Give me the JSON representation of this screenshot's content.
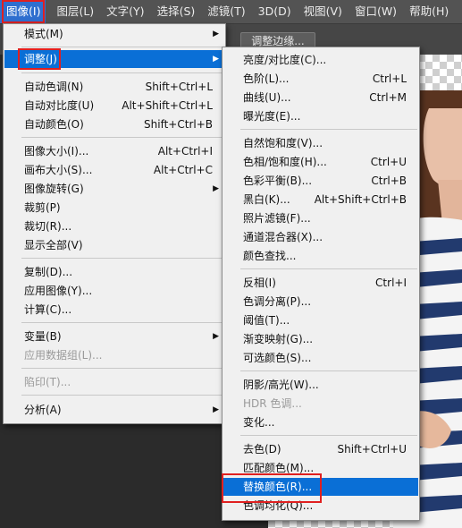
{
  "menubar": {
    "items": [
      "图像(I)",
      "图层(L)",
      "文字(Y)",
      "选择(S)",
      "滤镜(T)",
      "3D(D)",
      "视图(V)",
      "窗口(W)",
      "帮助(H)"
    ]
  },
  "options": {
    "edge_button": "调整边缘..."
  },
  "image_menu": {
    "items": [
      {
        "label": "模式(M)",
        "shortcut": "",
        "submenu": true
      },
      {
        "label": "调整(J)",
        "shortcut": "",
        "submenu": true,
        "highlighted": true
      },
      {
        "label": "自动色调(N)",
        "shortcut": "Shift+Ctrl+L"
      },
      {
        "label": "自动对比度(U)",
        "shortcut": "Alt+Shift+Ctrl+L"
      },
      {
        "label": "自动颜色(O)",
        "shortcut": "Shift+Ctrl+B"
      },
      {
        "label": "图像大小(I)...",
        "shortcut": "Alt+Ctrl+I"
      },
      {
        "label": "画布大小(S)...",
        "shortcut": "Alt+Ctrl+C"
      },
      {
        "label": "图像旋转(G)",
        "shortcut": "",
        "submenu": true
      },
      {
        "label": "裁剪(P)",
        "shortcut": ""
      },
      {
        "label": "裁切(R)...",
        "shortcut": ""
      },
      {
        "label": "显示全部(V)",
        "shortcut": ""
      },
      {
        "label": "复制(D)...",
        "shortcut": ""
      },
      {
        "label": "应用图像(Y)...",
        "shortcut": ""
      },
      {
        "label": "计算(C)...",
        "shortcut": ""
      },
      {
        "label": "变量(B)",
        "shortcut": "",
        "submenu": true
      },
      {
        "label": "应用数据组(L)...",
        "shortcut": "",
        "disabled": true
      },
      {
        "label": "陷印(T)...",
        "shortcut": "",
        "disabled": true
      },
      {
        "label": "分析(A)",
        "shortcut": "",
        "submenu": true
      }
    ]
  },
  "adjust_menu": {
    "items": [
      {
        "label": "亮度/对比度(C)...",
        "shortcut": ""
      },
      {
        "label": "色阶(L)...",
        "shortcut": "Ctrl+L"
      },
      {
        "label": "曲线(U)...",
        "shortcut": "Ctrl+M"
      },
      {
        "label": "曝光度(E)...",
        "shortcut": ""
      },
      {
        "label": "自然饱和度(V)...",
        "shortcut": ""
      },
      {
        "label": "色相/饱和度(H)...",
        "shortcut": "Ctrl+U"
      },
      {
        "label": "色彩平衡(B)...",
        "shortcut": "Ctrl+B"
      },
      {
        "label": "黑白(K)...",
        "shortcut": "Alt+Shift+Ctrl+B"
      },
      {
        "label": "照片滤镜(F)...",
        "shortcut": ""
      },
      {
        "label": "通道混合器(X)...",
        "shortcut": ""
      },
      {
        "label": "颜色查找...",
        "shortcut": ""
      },
      {
        "label": "反相(I)",
        "shortcut": "Ctrl+I"
      },
      {
        "label": "色调分离(P)...",
        "shortcut": ""
      },
      {
        "label": "阈值(T)...",
        "shortcut": ""
      },
      {
        "label": "渐变映射(G)...",
        "shortcut": ""
      },
      {
        "label": "可选颜色(S)...",
        "shortcut": ""
      },
      {
        "label": "阴影/高光(W)...",
        "shortcut": ""
      },
      {
        "label": "HDR 色调...",
        "shortcut": "",
        "disabled": true
      },
      {
        "label": "变化...",
        "shortcut": ""
      },
      {
        "label": "去色(D)",
        "shortcut": "Shift+Ctrl+U"
      },
      {
        "label": "匹配颜色(M)...",
        "shortcut": ""
      },
      {
        "label": "替换颜色(R)...",
        "shortcut": "",
        "highlighted": true
      },
      {
        "label": "色调均化(Q)...",
        "shortcut": ""
      }
    ]
  },
  "colors": {
    "highlight": "#0a6fd6",
    "menubar_active": "#2f6fcf",
    "annotation_red": "#e02020"
  }
}
